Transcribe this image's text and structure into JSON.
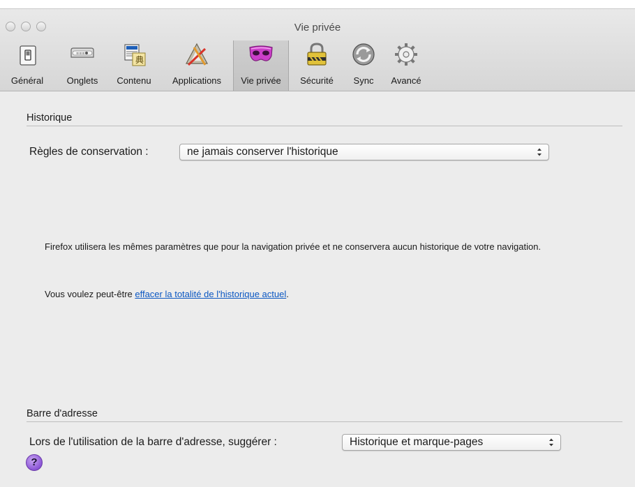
{
  "window": {
    "title": "Vie privée"
  },
  "toolbar": {
    "tabs": [
      {
        "label": "Général",
        "icon": "switch-icon"
      },
      {
        "label": "Onglets",
        "icon": "tabs-icon"
      },
      {
        "label": "Contenu",
        "icon": "content-icon"
      },
      {
        "label": "Applications",
        "icon": "applications-icon"
      },
      {
        "label": "Vie privée",
        "icon": "privacy-mask-icon",
        "selected": true
      },
      {
        "label": "Sécurité",
        "icon": "padlock-icon"
      },
      {
        "label": "Sync",
        "icon": "sync-icon"
      },
      {
        "label": "Avancé",
        "icon": "gear-icon"
      }
    ]
  },
  "history": {
    "section_title": "Historique",
    "rule_label": "Règles de conservation :",
    "rule_value": "ne jamais conserver l'historique",
    "description": "Firefox utilisera les mêmes paramètres que pour la navigation privée et ne conservera aucun historique de votre navigation.",
    "clear_prefix": "Vous voulez peut-être ",
    "clear_link": "effacer la totalité de l'historique actuel",
    "clear_suffix": "."
  },
  "addressbar": {
    "section_title": "Barre d'adresse",
    "suggest_label": "Lors de l'utilisation de la barre d'adresse, suggérer :",
    "suggest_value": "Historique et marque-pages"
  },
  "help": {
    "symbol": "?"
  },
  "colors": {
    "link": "#0b57c2",
    "background": "#ececec",
    "help_button": "#8b55d6"
  }
}
